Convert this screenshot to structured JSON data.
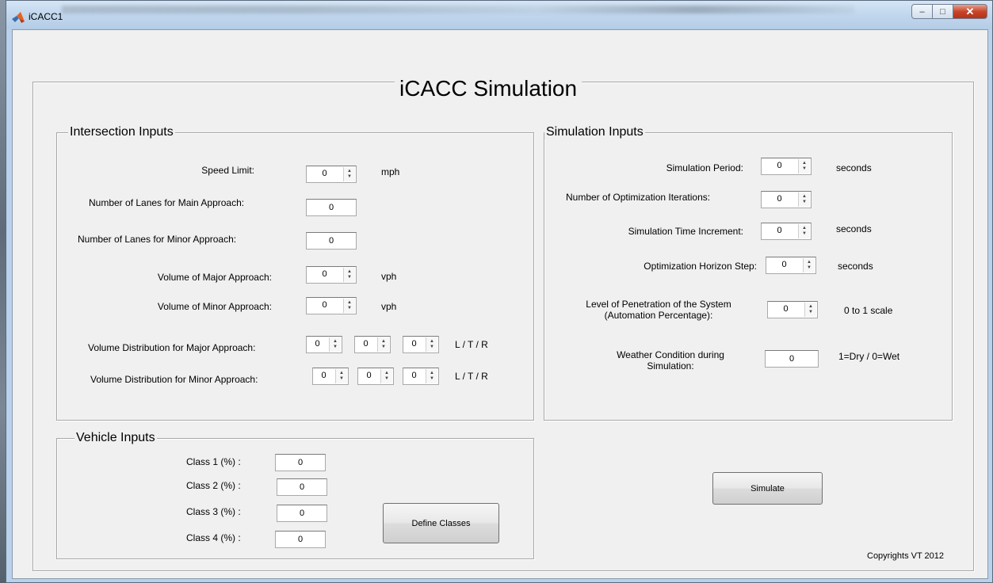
{
  "window": {
    "title": "iCACC1",
    "minimize": "–",
    "maximize": "□",
    "close": "✕"
  },
  "main_title": "iCACC Simulation",
  "intersection": {
    "title": "Intersection Inputs",
    "speed_limit": {
      "label": "Speed Limit:",
      "value": "0",
      "unit": "mph"
    },
    "lanes_main": {
      "label": "Number of Lanes for Main Approach:",
      "value": "0"
    },
    "lanes_minor": {
      "label": "Number of Lanes for Minor Approach:",
      "value": "0"
    },
    "vol_major": {
      "label": "Volume of Major Approach:",
      "value": "0",
      "unit": "vph"
    },
    "vol_minor": {
      "label": "Volume of Minor Approach:",
      "value": "0",
      "unit": "vph"
    },
    "dist_major": {
      "label": "Volume Distribution for Major Approach:",
      "values": [
        "0",
        "0",
        "0"
      ],
      "unit": "L / T / R"
    },
    "dist_minor": {
      "label": "Volume Distribution for Minor Approach:",
      "values": [
        "0",
        "0",
        "0"
      ],
      "unit": "L / T / R"
    }
  },
  "simulation": {
    "title": "Simulation Inputs",
    "period": {
      "label": "Simulation Period:",
      "value": "0",
      "unit": "seconds"
    },
    "iterations": {
      "label": "Number of Optimization Iterations:",
      "value": "0"
    },
    "time_inc": {
      "label": "Simulation Time Increment:",
      "value": "0",
      "unit": "seconds"
    },
    "horizon": {
      "label": "Optimization Horizon Step:",
      "value": "0",
      "unit": "seconds"
    },
    "penetration": {
      "label": "Level of Penetration of the System (Automation Percentage):",
      "value": "0",
      "unit": "0 to 1 scale"
    },
    "weather": {
      "label": "Weather Condition during Simulation:",
      "value": "0",
      "unit": "1=Dry / 0=Wet"
    }
  },
  "vehicle": {
    "title": "Vehicle Inputs",
    "classes": [
      {
        "label": "Class 1 (%) :",
        "value": "0"
      },
      {
        "label": "Class 2 (%) :",
        "value": "0"
      },
      {
        "label": "Class 3 (%) :",
        "value": "0"
      },
      {
        "label": "Class 4 (%) :",
        "value": "0"
      }
    ],
    "define_button": "Define Classes"
  },
  "simulate_button": "Simulate",
  "copyright": "Copyrights VT 2012"
}
